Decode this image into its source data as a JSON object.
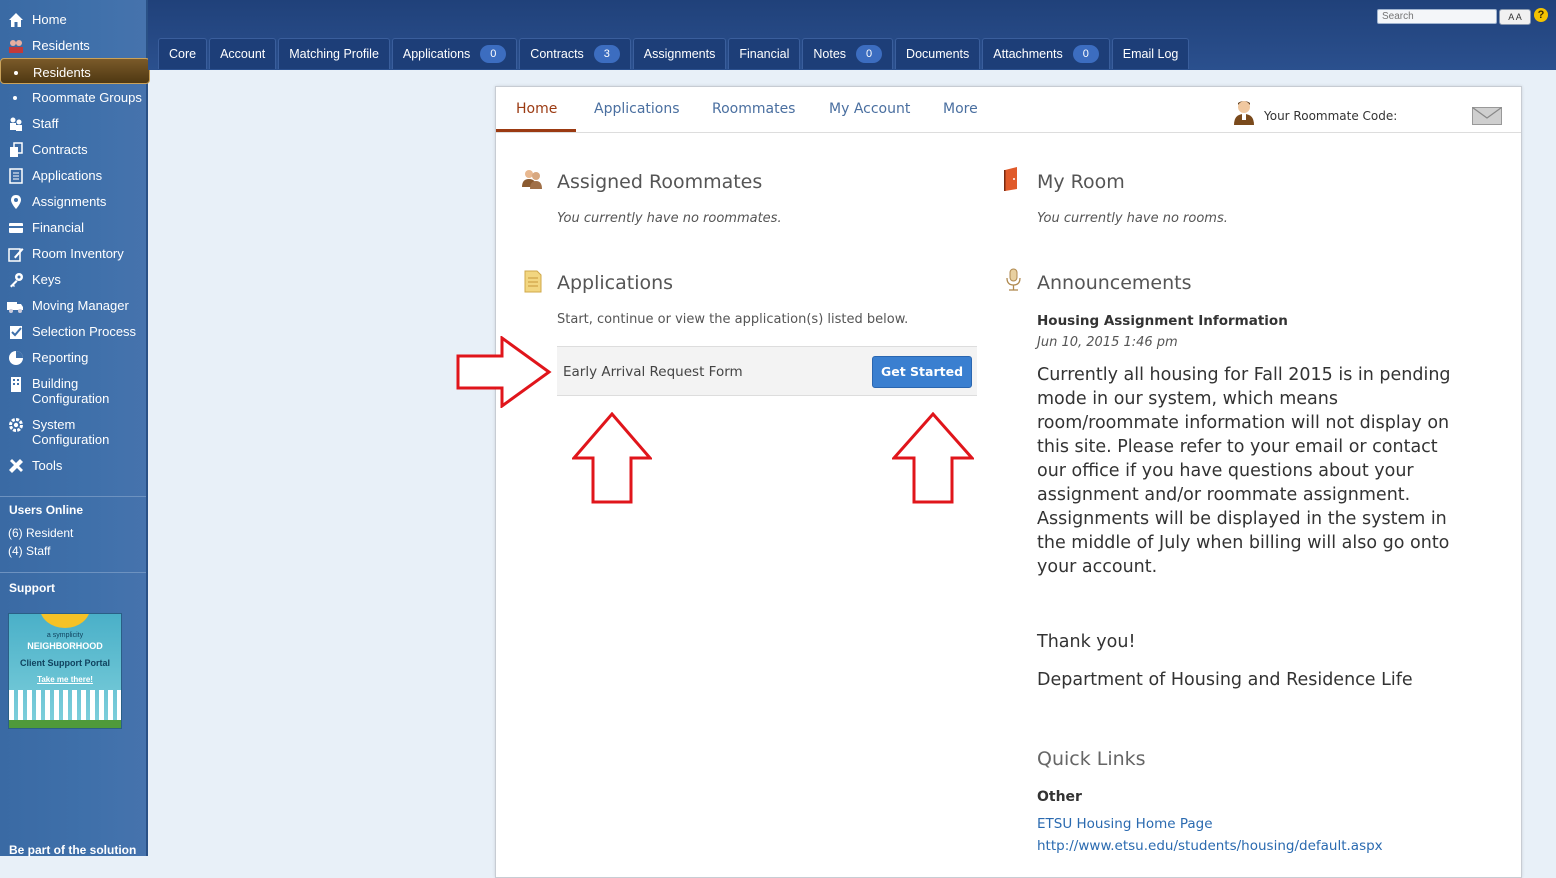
{
  "sidebar": {
    "items": [
      {
        "label": "Home",
        "icon": "home-icon"
      },
      {
        "label": "Residents",
        "icon": "residents-icon"
      },
      {
        "label": "Residents",
        "icon": "dot",
        "active": true
      },
      {
        "label": "Roommate Groups",
        "icon": "dot"
      },
      {
        "label": "Staff",
        "icon": "staff-icon"
      },
      {
        "label": "Contracts",
        "icon": "contracts-icon"
      },
      {
        "label": "Applications",
        "icon": "applications-icon"
      },
      {
        "label": "Assignments",
        "icon": "pin-icon"
      },
      {
        "label": "Financial",
        "icon": "card-icon"
      },
      {
        "label": "Room Inventory",
        "icon": "inventory-icon"
      },
      {
        "label": "Keys",
        "icon": "key-icon"
      },
      {
        "label": "Moving Manager",
        "icon": "truck-icon"
      },
      {
        "label": "Selection Process",
        "icon": "checklist-icon"
      },
      {
        "label": "Reporting",
        "icon": "pie-icon"
      },
      {
        "label": "Building Configuration",
        "icon": "building-icon"
      },
      {
        "label": "System Configuration",
        "icon": "gear-icon"
      },
      {
        "label": "Tools",
        "icon": "tools-icon"
      }
    ],
    "users_online": {
      "title": "Users Online",
      "resident": "(6) Resident",
      "staff": "(4) Staff"
    },
    "support": {
      "title": "Support",
      "logo_small": "a symplicity",
      "logo_big": "NEIGHBORHOOD",
      "logo_portal": "Client Support Portal",
      "logo_link": "Take me there!"
    },
    "bottom_text": "Be part of the solution"
  },
  "topbar": {
    "search_placeholder": "Search",
    "font_size_label": "A A",
    "help_label": "?",
    "tabs": [
      {
        "label": "Core"
      },
      {
        "label": "Account"
      },
      {
        "label": "Matching Profile"
      },
      {
        "label": "Applications",
        "badge": "0"
      },
      {
        "label": "Contracts",
        "badge": "3"
      },
      {
        "label": "Assignments"
      },
      {
        "label": "Financial"
      },
      {
        "label": "Notes",
        "badge": "0"
      },
      {
        "label": "Documents"
      },
      {
        "label": "Attachments",
        "badge": "0"
      },
      {
        "label": "Email Log"
      }
    ]
  },
  "panel": {
    "tabs": [
      "Home",
      "Applications",
      "Roommates",
      "My Account",
      "More"
    ],
    "active_tab": "Home",
    "roommate_code_label": "Your Roommate Code:",
    "assigned_roommates": {
      "title": "Assigned Roommates",
      "empty": "You currently have no roommates."
    },
    "my_room": {
      "title": "My Room",
      "empty": "You currently have no rooms."
    },
    "applications": {
      "title": "Applications",
      "intro": "Start, continue or view the application(s) listed below.",
      "row_name": "Early Arrival Request Form",
      "row_button": "Get Started"
    },
    "announcements": {
      "title": "Announcements",
      "item_title": "Housing Assignment Information",
      "item_date": "Jun 10, 2015 1:46 pm",
      "body": "Currently all housing for Fall 2015 is in pending mode in our system, which means room/roommate information will not display on this site.  Please refer to your email or contact our office if you have questions about your assignment and/or roommate assignment.  Assignments will be displayed in the system in the middle of July when billing will also go onto your account.",
      "thanks": "Thank you!",
      "dept": "Department of Housing and Residence Life"
    },
    "quick_links": {
      "title": "Quick Links",
      "category": "Other",
      "link_label": "ETSU Housing Home Page",
      "link_url": "http://www.etsu.edu/students/housing/default.aspx"
    }
  },
  "colors": {
    "accent": "#9b3a12",
    "link": "#2a6ab0",
    "button": "#3a7fd0",
    "annotation": "#e0151b"
  }
}
